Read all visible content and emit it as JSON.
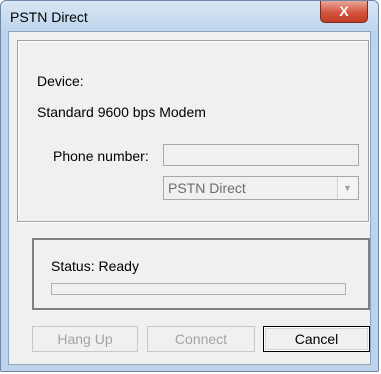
{
  "window": {
    "title": "PSTN Direct",
    "close_glyph": "X"
  },
  "device": {
    "label": "Device:",
    "name": "Standard  9600 bps Modem"
  },
  "phone": {
    "label": "Phone number:",
    "value": ""
  },
  "connection_combo": {
    "selected": "PSTN Direct",
    "arrow_icon": "chevron-down-icon"
  },
  "status": {
    "label": "Status: Ready",
    "progress": 0
  },
  "buttons": {
    "hang_up": "Hang Up",
    "connect": "Connect",
    "cancel": "Cancel"
  }
}
